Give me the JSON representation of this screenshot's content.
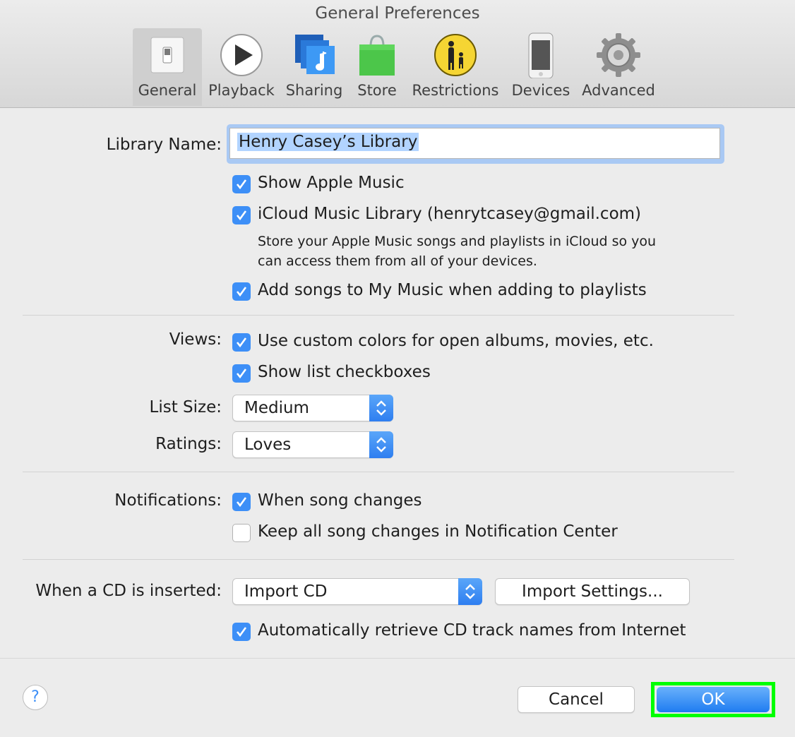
{
  "window": {
    "title": "General Preferences"
  },
  "toolbar": {
    "tabs": [
      {
        "label": "General",
        "icon": "switch-icon",
        "selected": true
      },
      {
        "label": "Playback",
        "icon": "play-icon"
      },
      {
        "label": "Sharing",
        "icon": "music-note-stack-icon"
      },
      {
        "label": "Store",
        "icon": "shopping-bag-icon"
      },
      {
        "label": "Restrictions",
        "icon": "parental-icon"
      },
      {
        "label": "Devices",
        "icon": "iphone-icon"
      },
      {
        "label": "Advanced",
        "icon": "gear-icon"
      }
    ]
  },
  "library": {
    "label": "Library Name:",
    "value": "Henry Casey’s Library",
    "show_apple_music": {
      "label": "Show Apple Music",
      "checked": true
    },
    "icloud": {
      "label": "iCloud Music Library (henrytcasey@gmail.com)",
      "checked": true,
      "description_line1": "Store your Apple Music songs and playlists in iCloud so you",
      "description_line2": "can access them from all of your devices."
    },
    "add_songs": {
      "label": "Add songs to My Music when adding to playlists",
      "checked": true
    }
  },
  "views": {
    "label": "Views:",
    "custom_colors": {
      "label": "Use custom colors for open albums, movies, etc.",
      "checked": true
    },
    "list_checkboxes": {
      "label": "Show list checkboxes",
      "checked": true
    },
    "list_size": {
      "label": "List Size:",
      "value": "Medium"
    },
    "ratings": {
      "label": "Ratings:",
      "value": "Loves"
    }
  },
  "notifications": {
    "label": "Notifications:",
    "song_changes": {
      "label": "When song changes",
      "checked": true
    },
    "keep_all": {
      "label": "Keep all song changes in Notification Center",
      "checked": false
    }
  },
  "cd": {
    "label": "When a CD is inserted:",
    "action": "Import CD",
    "import_settings": "Import Settings...",
    "auto_retrieve": {
      "label": "Automatically retrieve CD track names from Internet",
      "checked": true
    }
  },
  "footer": {
    "help": "?",
    "cancel": "Cancel",
    "ok": "OK"
  },
  "colors": {
    "accent": "#3d8ff7",
    "highlight": "#00ff00"
  }
}
